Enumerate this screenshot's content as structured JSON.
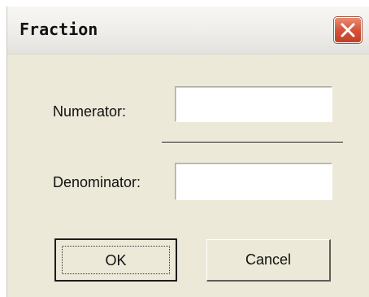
{
  "dialog": {
    "title": "Fraction"
  },
  "form": {
    "numerator_label": "Numerator:",
    "numerator_value": "",
    "denominator_label": "Denominator:",
    "denominator_value": ""
  },
  "buttons": {
    "ok_label": "OK",
    "cancel_label": "Cancel"
  },
  "icons": {
    "close": "close-icon"
  },
  "colors": {
    "close_button": "#d5533a",
    "dialog_background": "#ece9d8"
  }
}
